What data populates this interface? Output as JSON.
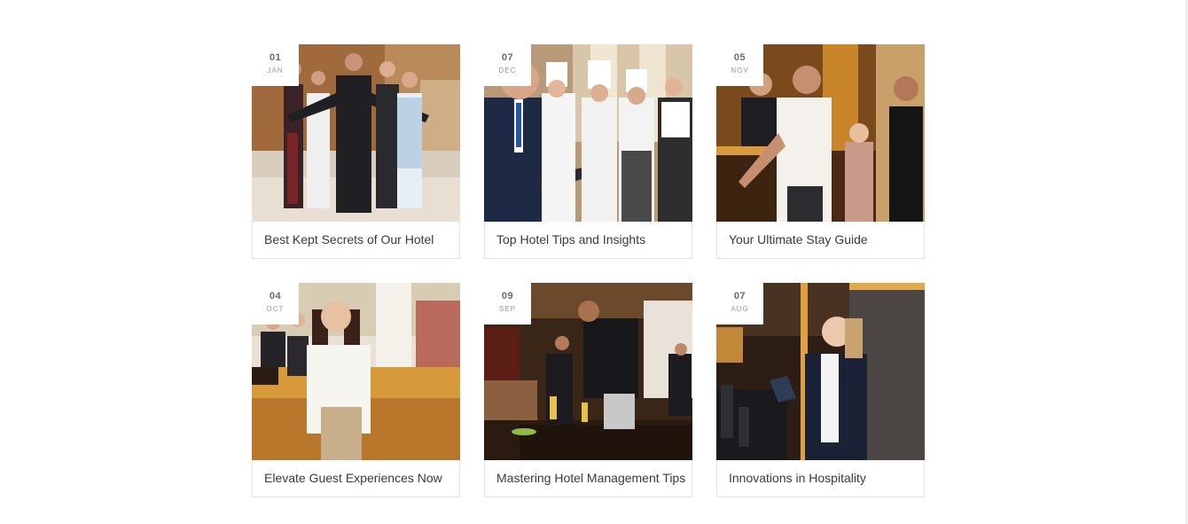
{
  "posts": [
    {
      "day": "01",
      "month": "JAN",
      "title": "Best Kept Secrets of Our Hotel",
      "image": "hotel-staff-group-photo"
    },
    {
      "day": "07",
      "month": "DEC",
      "title": "Top Hotel Tips and Insights",
      "image": "chefs-and-manager-photo"
    },
    {
      "day": "05",
      "month": "NOV",
      "title": "Your Ultimate Stay Guide",
      "image": "reception-checkin-photo"
    },
    {
      "day": "04",
      "month": "OCT",
      "title": "Elevate Guest Experiences Now",
      "image": "guest-in-lobby-photo"
    },
    {
      "day": "09",
      "month": "SEP",
      "title": "Mastering Hotel Management Tips",
      "image": "restaurant-service-photo"
    },
    {
      "day": "07",
      "month": "AUG",
      "title": "Innovations in Hospitality",
      "image": "receptionist-tablet-photo"
    }
  ],
  "colors": {
    "card_border": "#e3e3e3",
    "caption_text": "#3a3a3a",
    "date_day": "#6b6b6b",
    "date_month": "#9a9a9a"
  }
}
